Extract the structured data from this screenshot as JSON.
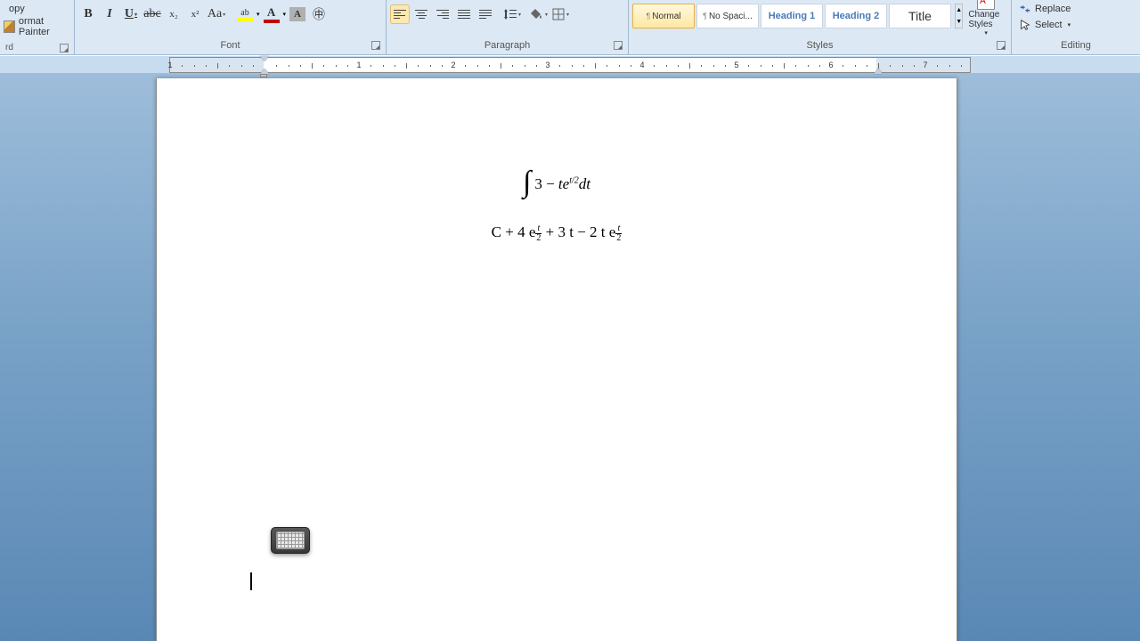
{
  "clipboard": {
    "copy": "opy",
    "format_painter": "ormat Painter",
    "rd_label": "rd"
  },
  "font": {
    "group_label": "Font",
    "bold": "B",
    "italic": "I",
    "underline": "U",
    "strike": "abc",
    "subscript": "x₂",
    "superscript": "x²",
    "case": "Aa",
    "highlight": "ab",
    "fontcolor": "A",
    "charshading": "A",
    "enclose": "㊥"
  },
  "paragraph": {
    "group_label": "Paragraph"
  },
  "styles": {
    "group_label": "Styles",
    "items": [
      {
        "label": "Normal",
        "selected": true,
        "pilcrow": true
      },
      {
        "label": "No Spaci...",
        "selected": false,
        "pilcrow": true
      },
      {
        "label": "Heading 1",
        "selected": false,
        "heading": true
      },
      {
        "label": "Heading 2",
        "selected": false,
        "heading": true
      },
      {
        "label": "Title",
        "selected": false,
        "title": true
      }
    ],
    "change_styles": "Change Styles"
  },
  "editing": {
    "group_label": "Editing",
    "replace": "Replace",
    "select": "Select"
  },
  "ruler": {
    "numbers": [
      "1",
      "1",
      "2",
      "3",
      "4",
      "5",
      "6",
      "7"
    ]
  },
  "document": {
    "eq1": {
      "int": "∫",
      "body_a": "3 − ",
      "body_b": "te",
      "exp": "t/2",
      "body_c": "dt"
    },
    "eq2": {
      "a": "C + 4 e",
      "exp1_num": "t",
      "exp1_den": "2",
      "b": " + 3 t − 2 t e",
      "exp2_num": "t",
      "exp2_den": "2"
    }
  }
}
